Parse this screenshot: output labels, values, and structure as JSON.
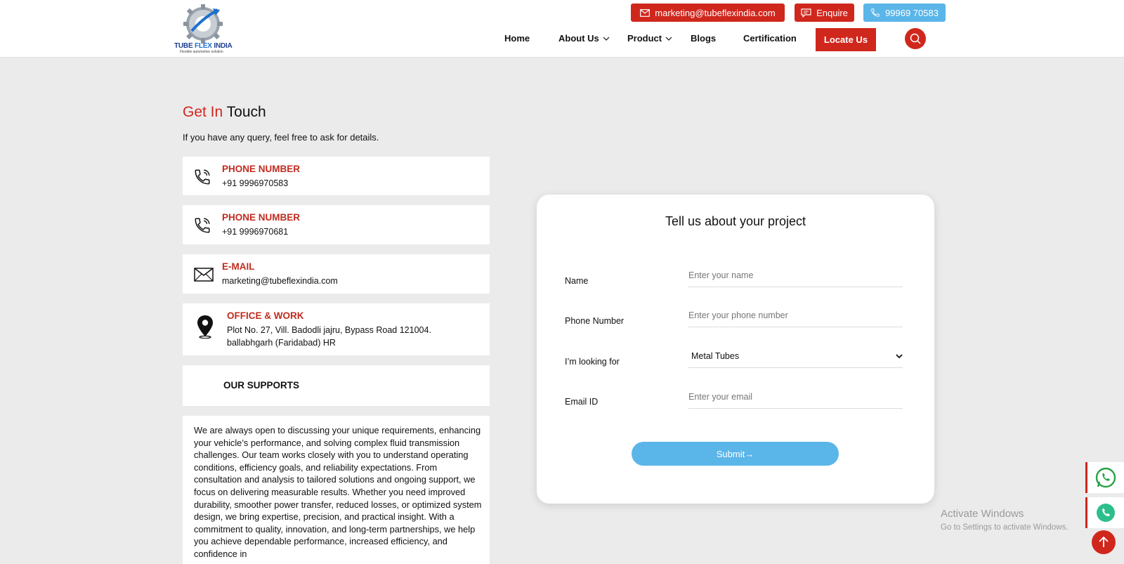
{
  "brand": {
    "name_part1": "TUBE ",
    "name_part2": "FLEX",
    "name_part3": " INDIA",
    "tagline": "Flexible automotive solution"
  },
  "topbar": {
    "email": "marketing@tubeflexindia.com",
    "enquire": "Enquire",
    "phone": "99969 70583"
  },
  "nav": {
    "home": "Home",
    "about": "About Us",
    "product": "Product",
    "blogs": "Blogs",
    "certification": "Certification",
    "locate": "Locate Us"
  },
  "contact": {
    "title_red": "Get In",
    "title_dark": " Touch",
    "subtitle": "If you have any query, feel free to ask for details.",
    "cards": [
      {
        "label": "PHONE NUMBER",
        "value": "+91 9996970583",
        "icon": "phone-icon"
      },
      {
        "label": "PHONE NUMBER",
        "value": "+91 9996970681",
        "icon": "phone-icon"
      },
      {
        "label": "E-MAIL",
        "value": "marketing@tubeflexindia.com",
        "icon": "mail-icon"
      },
      {
        "label": "OFFICE & WORK",
        "value_line1": "Plot No. 27, Vill. Badodli jajru, Bypass Road 121004.",
        "value_line2": "ballabhgarh (Faridabad) HR",
        "icon": "location-icon"
      }
    ],
    "supports_label": "OUR SUPPORTS",
    "supports_text": "We are always open to discussing your unique requirements, enhancing your vehicle’s performance, and solving complex fluid transmission challenges. Our team works closely with you to understand operating conditions, efficiency goals, and reliability expectations. From consultation and analysis to tailored solutions and ongoing support, we focus on delivering measurable results. Whether you need improved durability, smoother power transfer, reduced losses, or optimized system design, we bring expertise, precision, and practical insight. With a commitment to quality, innovation, and long-term partnerships, we help you achieve dependable performance, increased efficiency, and confidence in"
  },
  "form": {
    "title": "Tell us about your project",
    "name_label": "Name",
    "name_placeholder": "Enter your name",
    "phone_label": "Phone Number",
    "phone_placeholder": "Enter your phone number",
    "looking_label": "I’m looking for",
    "looking_value": "Metal Tubes",
    "email_label": "Email ID",
    "email_placeholder": "Enter your email",
    "submit": "Submit→"
  },
  "watermark": {
    "title": "Activate Windows",
    "subtitle": "Go to Settings to activate Windows."
  },
  "colors": {
    "accent_red": "#d0271d",
    "accent_blue": "#5ab5e8",
    "background": "#ebebeb"
  }
}
